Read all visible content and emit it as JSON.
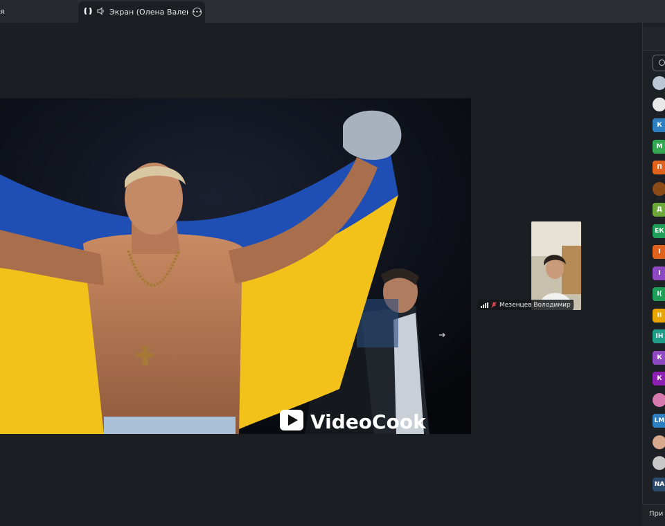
{
  "tabs": {
    "left_tab_label": "я",
    "active_tab_title": "Экран (Олена Валентинівна"
  },
  "video": {
    "watermark_text": "VideoCook"
  },
  "participant_tile": {
    "name": "Мезенцев Володимир"
  },
  "sidebar": {
    "avatars": [
      {
        "initials": "",
        "color": "#b9c7d6",
        "kind": "image"
      },
      {
        "initials": "",
        "color": "#e9e9e9",
        "kind": "image"
      },
      {
        "initials": "К",
        "color": "#2d7fc1",
        "kind": "initial"
      },
      {
        "initials": "М",
        "color": "#34a853",
        "kind": "initial"
      },
      {
        "initials": "П",
        "color": "#e0621c",
        "kind": "initial"
      },
      {
        "initials": "",
        "color": "#8a4b16",
        "kind": "image"
      },
      {
        "initials": "Д",
        "color": "#6ca83a",
        "kind": "initial"
      },
      {
        "initials": "ЕК",
        "color": "#1f9e57",
        "kind": "initial"
      },
      {
        "initials": "І",
        "color": "#e0621c",
        "kind": "initial"
      },
      {
        "initials": "І",
        "color": "#8e49c2",
        "kind": "initial"
      },
      {
        "initials": "І(",
        "color": "#1f9e57",
        "kind": "initial"
      },
      {
        "initials": "ІІ",
        "color": "#e8a400",
        "kind": "initial"
      },
      {
        "initials": "ІН",
        "color": "#1f9e8a",
        "kind": "initial"
      },
      {
        "initials": "К",
        "color": "#8e49c2",
        "kind": "initial"
      },
      {
        "initials": "К",
        "color": "#8e1fb3",
        "kind": "initial"
      },
      {
        "initials": "",
        "color": "#d87ab0",
        "kind": "image"
      },
      {
        "initials": "LM",
        "color": "#2d7fc1",
        "kind": "initial"
      },
      {
        "initials": "",
        "color": "#d9a98c",
        "kind": "image"
      },
      {
        "initials": "",
        "color": "#c8c8c8",
        "kind": "image"
      },
      {
        "initials": "NA",
        "color": "#2b4a6b",
        "kind": "initial"
      }
    ],
    "join_label": "При"
  },
  "colors": {
    "background": "#1b1f23",
    "flag_blue": "#1f4fb5",
    "flag_yellow": "#f2c21b"
  }
}
